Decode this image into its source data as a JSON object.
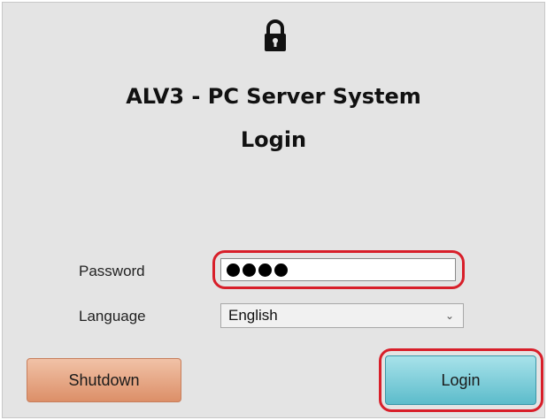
{
  "window": {
    "title_line1": "ALV3 - PC Server System",
    "title_line2": "Login"
  },
  "form": {
    "password_label": "Password",
    "password_masked_length": 4,
    "language_label": "Language",
    "language_selected": "English"
  },
  "buttons": {
    "shutdown_label": "Shutdown",
    "login_label": "Login"
  },
  "icons": {
    "lock": "lock-icon",
    "dropdown": "chevron-down-icon"
  },
  "colors": {
    "highlight": "#d81f2a",
    "shutdown_button": "#e9a582",
    "login_button": "#7ccfdb",
    "background": "#e4e4e4"
  }
}
